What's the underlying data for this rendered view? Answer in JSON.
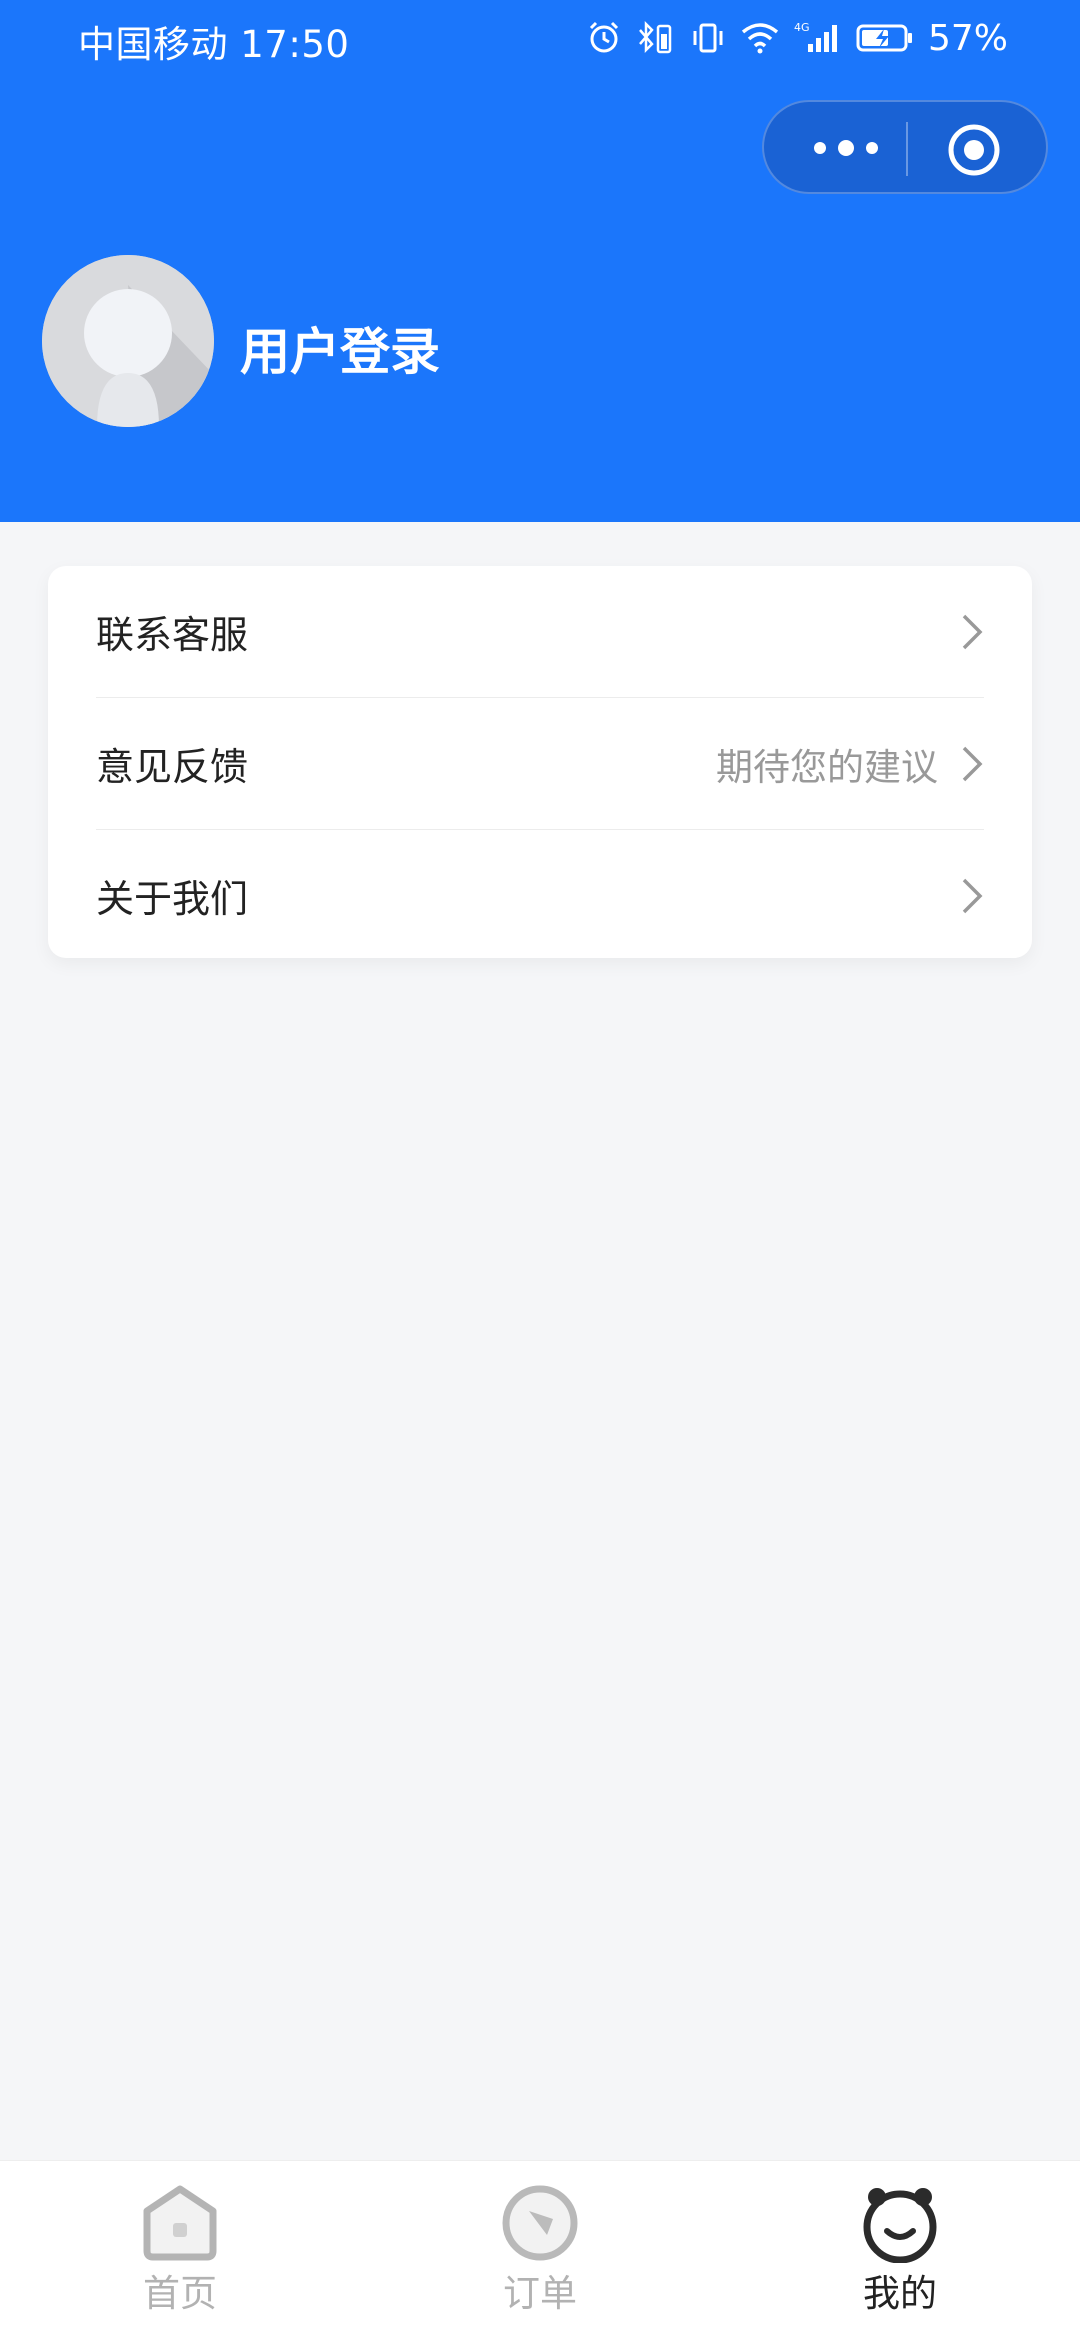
{
  "status_bar": {
    "carrier": "中国移动",
    "time": "17:50",
    "network": "4G",
    "battery": "57%"
  },
  "header": {
    "login_label": "用户登录"
  },
  "menu": {
    "items": [
      {
        "label": "联系客服",
        "hint": ""
      },
      {
        "label": "意见反馈",
        "hint": "期待您的建议"
      },
      {
        "label": "关于我们",
        "hint": ""
      }
    ]
  },
  "tabbar": {
    "tabs": [
      {
        "label": "首页",
        "icon": "home-icon"
      },
      {
        "label": "订单",
        "icon": "compass-icon"
      },
      {
        "label": "我的",
        "icon": "profile-face-icon"
      }
    ],
    "active_index": 2
  },
  "colors": {
    "brand": "#1b76fb",
    "background": "#f5f6f8"
  }
}
